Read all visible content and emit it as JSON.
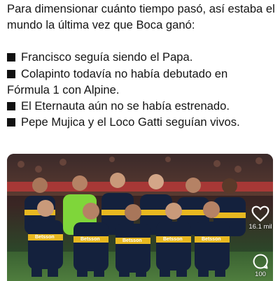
{
  "post": {
    "intro": "Para dimensionar cuánto tiempo pasó, así estaba el mundo la última vez que Boca ganó:",
    "bullets": [
      "Francisco seguía siendo el Papa.",
      "Colapinto todavía no había debutado en",
      "Fórmula 1 con Alpine.",
      "El Eternauta aún no se había estrenado.",
      "Pepe Mujica y el Loco Gatti seguían vivos."
    ]
  },
  "media": {
    "jersey_text": "Betsson",
    "jersey_primary": "#14213d",
    "jersey_stripe": "#e8b820",
    "gk_color": "#7fd63a",
    "pitch_color": "#3f6b33"
  },
  "actions": {
    "like_count": "16.1 mil",
    "comment_count": "100"
  }
}
